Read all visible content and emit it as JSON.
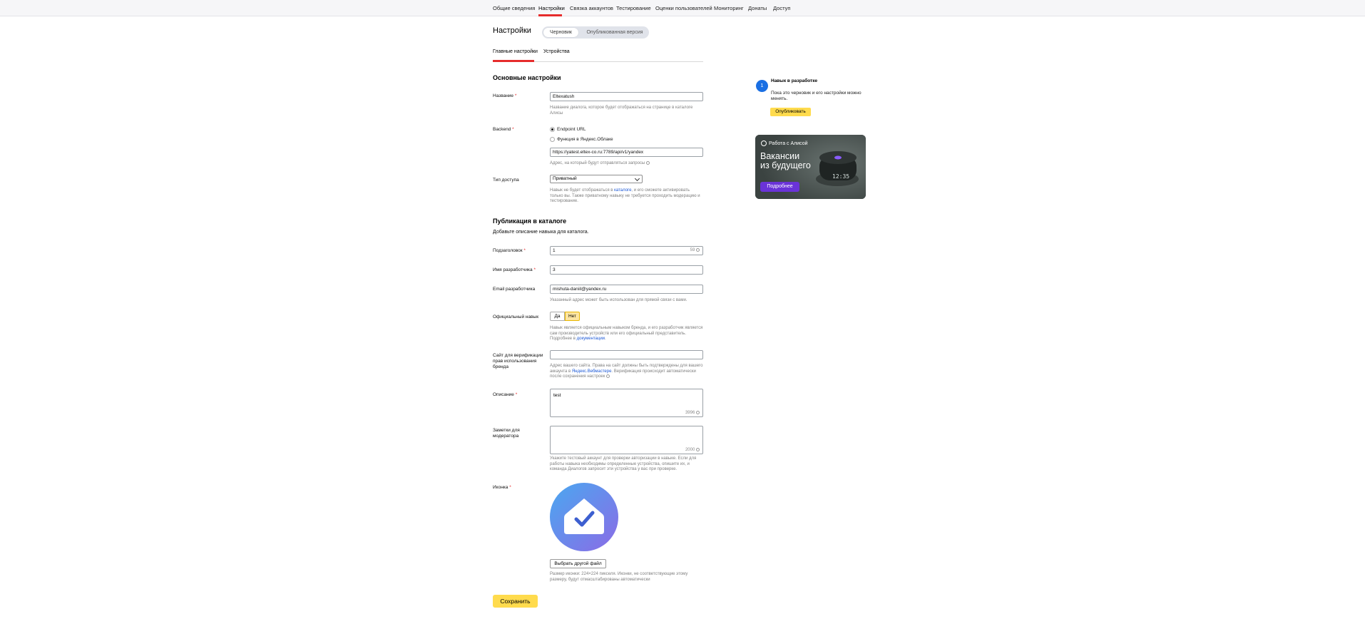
{
  "nav": {
    "items": [
      "Общие сведения",
      "Настройки",
      "Связка аккаунтов",
      "Тестирование",
      "Оценки пользователей",
      "Мониторинг",
      "Донаты",
      "Доступ"
    ],
    "active": "Настройки"
  },
  "page": {
    "title": "Настройки",
    "version_draft": "Черновик",
    "version_published": "Опубликованная версия",
    "subtabs": [
      "Главные настройки",
      "Устройства"
    ]
  },
  "main": {
    "section_title": "Основные настройки",
    "name_label": "Название",
    "name_value": "Eltexatush",
    "name_hint": "Название диалога, которое будет отображаться на странице в каталоге Алисы",
    "backend_label": "Backend",
    "backend_opt1": "Endpoint URL",
    "backend_opt2": "Функция в Яндекс.Облаке",
    "backend_url": "https://yatest.eltex-co.ru:7789/api/v1/yandex",
    "backend_hint": "Адрес, на который будут отправляться запросы",
    "access_label": "Тип доступа",
    "access_value": "Приватный",
    "access_hint_1": "Навык не будет отображаться в ",
    "access_hint_link": "каталоге",
    "access_hint_2": ", и его сможете активировать только вы. Также приватному навыку не требуется проходить модерацию и тестирование."
  },
  "catalog": {
    "section_title": "Публикация в каталоге",
    "subtitle": "Добавьте описание навыка для каталога.",
    "subheader_label": "Подзаголовок",
    "subheader_value": "1",
    "subheader_counter": "59",
    "dev_name_label": "Имя разработчика",
    "dev_name_value": "3",
    "email_label": "Email разработчика",
    "email_value": "mishuta-daniil@yandex.ru",
    "email_hint": "Указанный адрес может быть использован для прямой связи с вами.",
    "official_label": "Официальный навык",
    "official_yes": "Да",
    "official_no": "Нет",
    "official_hint_1": "Навык является официальным навыком бренда, и его разработчик является сам производитель устройств или его официальный представитель. Подробнее в ",
    "official_hint_link": "документации",
    "official_hint_2": ".",
    "site_label": "Сайт для верификации прав использования бренда",
    "site_value": "",
    "site_hint_1": "Адрес вашего сайта. Права на сайт должны быть подтверждены для вашего аккаунта в ",
    "site_hint_link": "Яндекс.Вебмастере",
    "site_hint_2": ". Верификация происходит автоматически после сохранения настроек",
    "description_label": "Описание",
    "description_value": "test",
    "description_counter": "3996",
    "notes_label": "Заметки для модератора",
    "notes_value": "",
    "notes_counter": "2000",
    "notes_hint": "Укажите тестовый аккаунт для проверки авторизации в навыке. Если для работы навыка необходимы определенные устройства, опишите их, и команда Диалогов запросит эти устройства у вас при проверке.",
    "icon_label": "Иконка",
    "choose_file": "Выбрать другой файл",
    "icon_hint": "Размер иконки: 224×224 пикселя. Иконки, не соответствующие этому размеру, будут отмасштабированы автоматически",
    "save": "Сохранить"
  },
  "sidebar": {
    "step_number": "1",
    "title": "Навык в разработке",
    "text": "Пока это черновик и его настройки можно менять.",
    "publish": "Опубликовать",
    "promo_brand": "Работа с Алисой",
    "promo_line1": "Вакансии",
    "promo_line2": "из будущего",
    "promo_more": "Подробнее",
    "promo_clock": "12:35"
  },
  "colors": {
    "accent_red": "#e62c2c",
    "yellow": "#ffdb4d",
    "link_blue": "#1a57d6",
    "promo_purple": "#6a33d8"
  }
}
